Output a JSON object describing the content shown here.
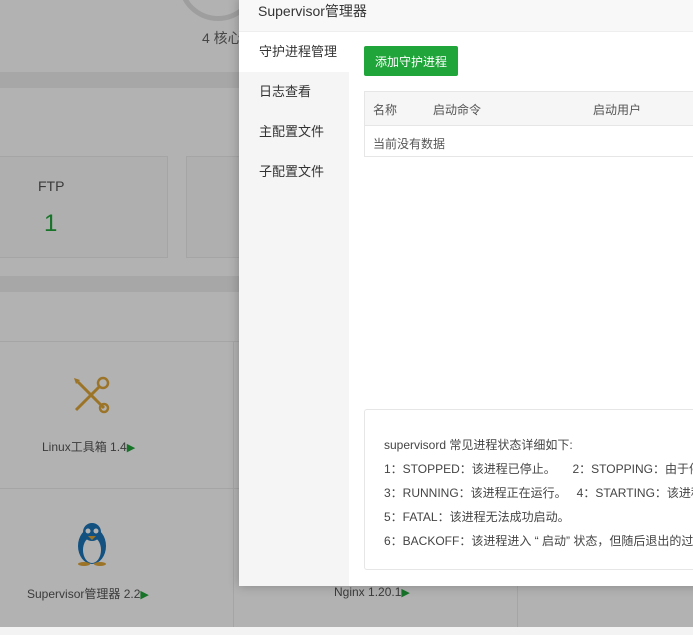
{
  "background": {
    "cores_text": "4 核心",
    "ftp_label": "FTP",
    "ftp_count": "1",
    "soft_items": [
      {
        "name": "Linux工具箱 1.4",
        "icon": "tools-icon"
      },
      {
        "name": "Supervisor管理器 2.2",
        "icon": "penguin-icon"
      },
      {
        "name": "Nginx 1.20.1",
        "icon": ""
      }
    ],
    "arrow": "▶"
  },
  "modal": {
    "title": "Supervisor管理器",
    "sidebar": [
      {
        "label": "守护进程管理",
        "active": true
      },
      {
        "label": "日志查看",
        "active": false
      },
      {
        "label": "主配置文件",
        "active": false
      },
      {
        "label": "子配置文件",
        "active": false
      }
    ],
    "add_button": "添加守护进程",
    "table": {
      "columns": [
        "名称",
        "启动命令",
        "启动用户"
      ],
      "empty_text": "当前没有数据"
    },
    "info": {
      "lines": [
        "supervisord 常见进程状态详细如下:",
        "1：STOPPED：该进程已停止。     2：STOPPING：由于停",
        "3：RUNNING：该进程正在运行。   4：STARTING：该进程",
        "5：FATAL：该进程无法成功启动。",
        "6：BACKOFF：该进程进入 “ 启动” 状态，但随后退出的过"
      ]
    }
  },
  "colors": {
    "accent": "#20a53a"
  }
}
